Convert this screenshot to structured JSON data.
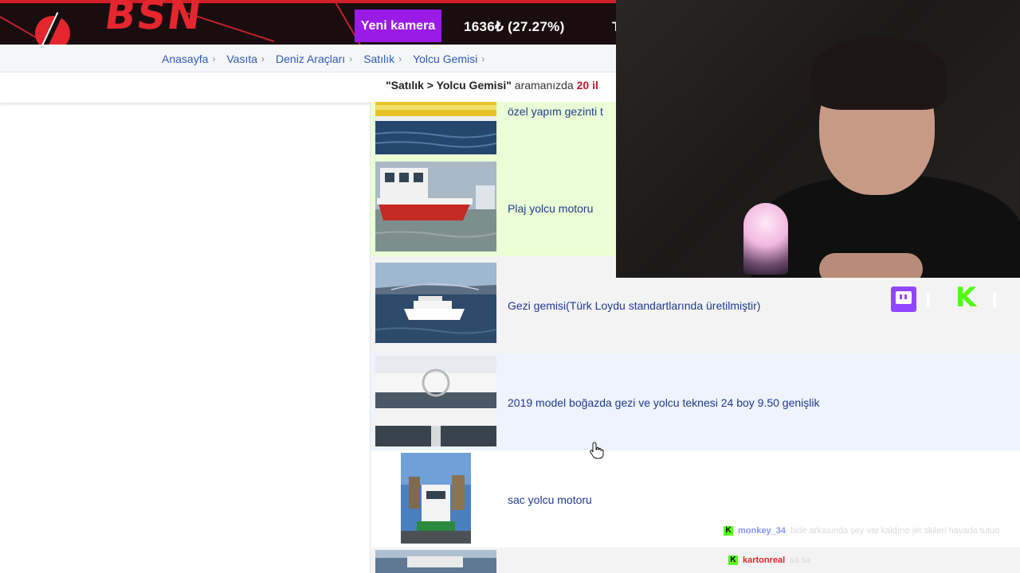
{
  "stream_bar": {
    "logo_text": "BSN",
    "camera_label": "Yeni kamera",
    "price_text": "1636₺ (27.27%)",
    "price_extra": "T"
  },
  "breadcrumb": {
    "items": [
      "Anasayfa",
      "Vasıta",
      "Deniz Araçları",
      "Satılık",
      "Yolcu Gemisi"
    ]
  },
  "search_result": {
    "query": "\"Satılık > Yolcu Gemisi\"",
    "text": " aramanızda ",
    "count": "20 il"
  },
  "listings": [
    {
      "title": "özel yapım gezinti t",
      "highlight": "green"
    },
    {
      "title": "Plaj yolcu motoru",
      "highlight": "green"
    },
    {
      "title": "Gezi gemisi(Türk Loydu standartlarında üretilmiştir)",
      "highlight": "grey"
    },
    {
      "title": "2019 model boğazda gezi ve yolcu teknesi 24 boy 9.50 genişlik",
      "highlight": "blue"
    },
    {
      "title": "sac yolcu motoru",
      "highlight": "white"
    },
    {
      "title": "",
      "highlight": "grey"
    }
  ],
  "overlay": {
    "twitch_icon": "twitch-icon",
    "kick_icon": "kick-icon",
    "kick_letter": "K"
  },
  "chat": [
    {
      "user": "monkey_34",
      "message": "bide arkasında şey var kaldırıo jet skileri havada tutuo",
      "user_color": "#8a94ff"
    },
    {
      "user": "kartonreal",
      "message": "sa sa",
      "user_color": "#e0272f"
    }
  ],
  "colors": {
    "accent_red": "#d0202a",
    "camera_purple": "#9a1be6",
    "link_blue": "#2f5bb7",
    "count_red": "#c6152b",
    "kick_green": "#53fc18",
    "twitch_purple": "#9146ff"
  }
}
